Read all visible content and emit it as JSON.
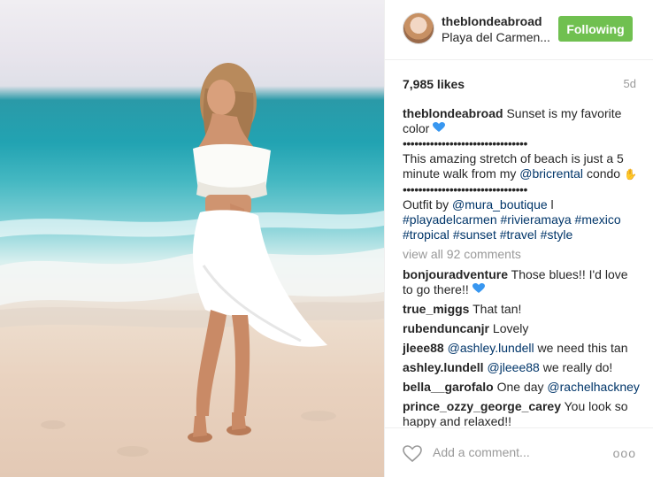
{
  "post": {
    "username": "theblondeabroad",
    "location": "Playa del Carmen...",
    "follow_label": "Following",
    "likes": "7,985 likes",
    "age": "5d",
    "caption": {
      "user": "theblondeabroad",
      "line1": "Sunset is my favorite color",
      "dots1": "••••••••••••••••••••••••••••••••",
      "line2_pre": "This amazing stretch of beach is just a 5 minute walk from my",
      "line2_mention": "@bricrental",
      "line2_post": "condo",
      "dots2": "••••••••••••••••••••••••••••••••",
      "outfit_pre": "Outfit by",
      "outfit_mention": "@mura_boutique",
      "outfit_bar": "l",
      "tags": [
        "#playadelcarmen",
        "#rivieramaya",
        "#mexico",
        "#tropical",
        "#sunset",
        "#travel",
        "#style"
      ]
    },
    "view_all": "view all 92 comments",
    "comments": [
      {
        "user": "bonjouradventure",
        "text": "Those blues!! I'd love to go there!!"
      },
      {
        "user": "true_miggs",
        "text": "That tan!"
      },
      {
        "user": "rubenduncanjr",
        "text": "Lovely"
      },
      {
        "user": "jleee88",
        "mention": "@ashley.lundell",
        "text": "we need this tan"
      },
      {
        "user": "ashley.lundell",
        "mention": "@jleee88",
        "text": "we really do!"
      },
      {
        "user": "bella__garofalo",
        "text": "One day",
        "mention_after": "@rachelhackney"
      },
      {
        "user": "prince_ozzy_george_carey",
        "text": "You look so happy and relaxed!!"
      }
    ],
    "add_comment_placeholder": "Add a comment...",
    "more_label": "ooo",
    "colors": {
      "follow": "#70c050",
      "hashtag": "#003569",
      "heart_emoji": "#3897f0"
    }
  }
}
